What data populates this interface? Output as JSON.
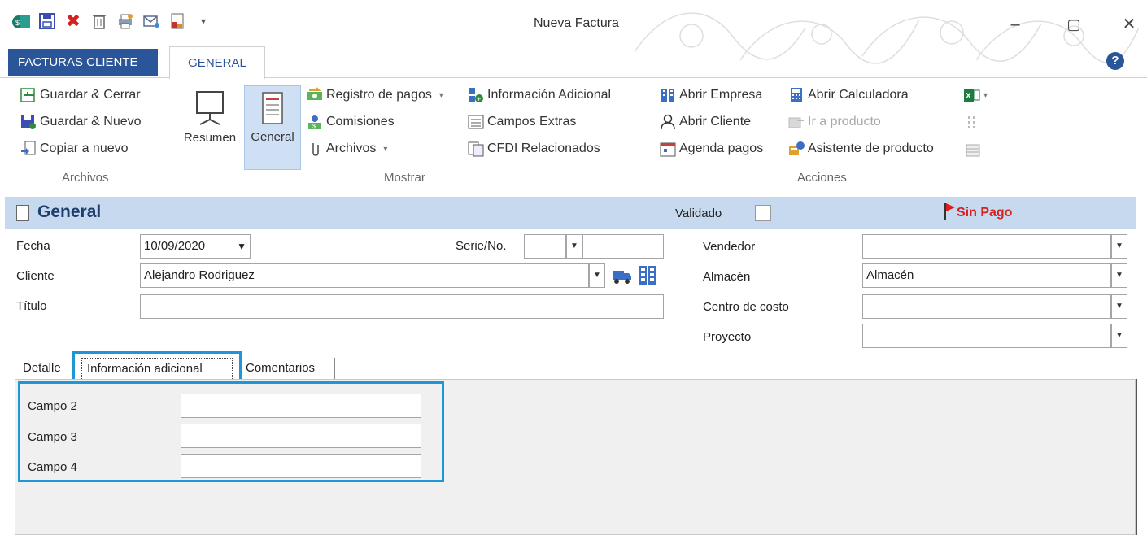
{
  "window": {
    "title": "Nueva Factura",
    "minimize": "–",
    "maximize": "▢",
    "close": "✕"
  },
  "tabs": {
    "facturas": "FACTURAS CLIENTE",
    "general": "GENERAL"
  },
  "ribbon": {
    "archivos": {
      "label": "Archivos",
      "guardar_cerrar": "Guardar & Cerrar",
      "guardar_nuevo": "Guardar & Nuevo",
      "copiar_nuevo": "Copiar a nuevo"
    },
    "mostrar": {
      "label": "Mostrar",
      "resumen": "Resumen",
      "general": "General",
      "registro_pagos": "Registro de pagos",
      "comisiones": "Comisiones",
      "archivos": "Archivos",
      "info_adicional": "Información Adicional",
      "campos_extras": "Campos Extras",
      "cfdi": "CFDI Relacionados"
    },
    "acciones": {
      "label": "Acciones",
      "abrir_empresa": "Abrir Empresa",
      "abrir_cliente": "Abrir Cliente",
      "agenda_pagos": "Agenda pagos",
      "abrir_calculadora": "Abrir Calculadora",
      "ir_producto": "Ir a producto",
      "asistente": "Asistente de producto"
    }
  },
  "section": {
    "title": "General",
    "validado": "Validado",
    "status": "Sin Pago",
    "status_color": "#d82020"
  },
  "form": {
    "fecha_label": "Fecha",
    "fecha_value": "10/09/2020",
    "serie_label": "Serie/No.",
    "cliente_label": "Cliente",
    "cliente_value": "Alejandro Rodriguez",
    "titulo_label": "Título",
    "vendedor_label": "Vendedor",
    "almacen_label": "Almacén",
    "almacen_value": "Almacén",
    "centro_label": "Centro de costo",
    "proyecto_label": "Proyecto"
  },
  "lower_tabs": {
    "detalle": "Detalle",
    "info": "Información adicional",
    "comentarios": "Comentarios"
  },
  "campos": {
    "campo2": "Campo 2",
    "campo3": "Campo 3",
    "campo4": "Campo 4"
  },
  "colors": {
    "accent": "#2a5599",
    "highlight": "#1f97d6",
    "section_bg": "#c7d9ee"
  }
}
